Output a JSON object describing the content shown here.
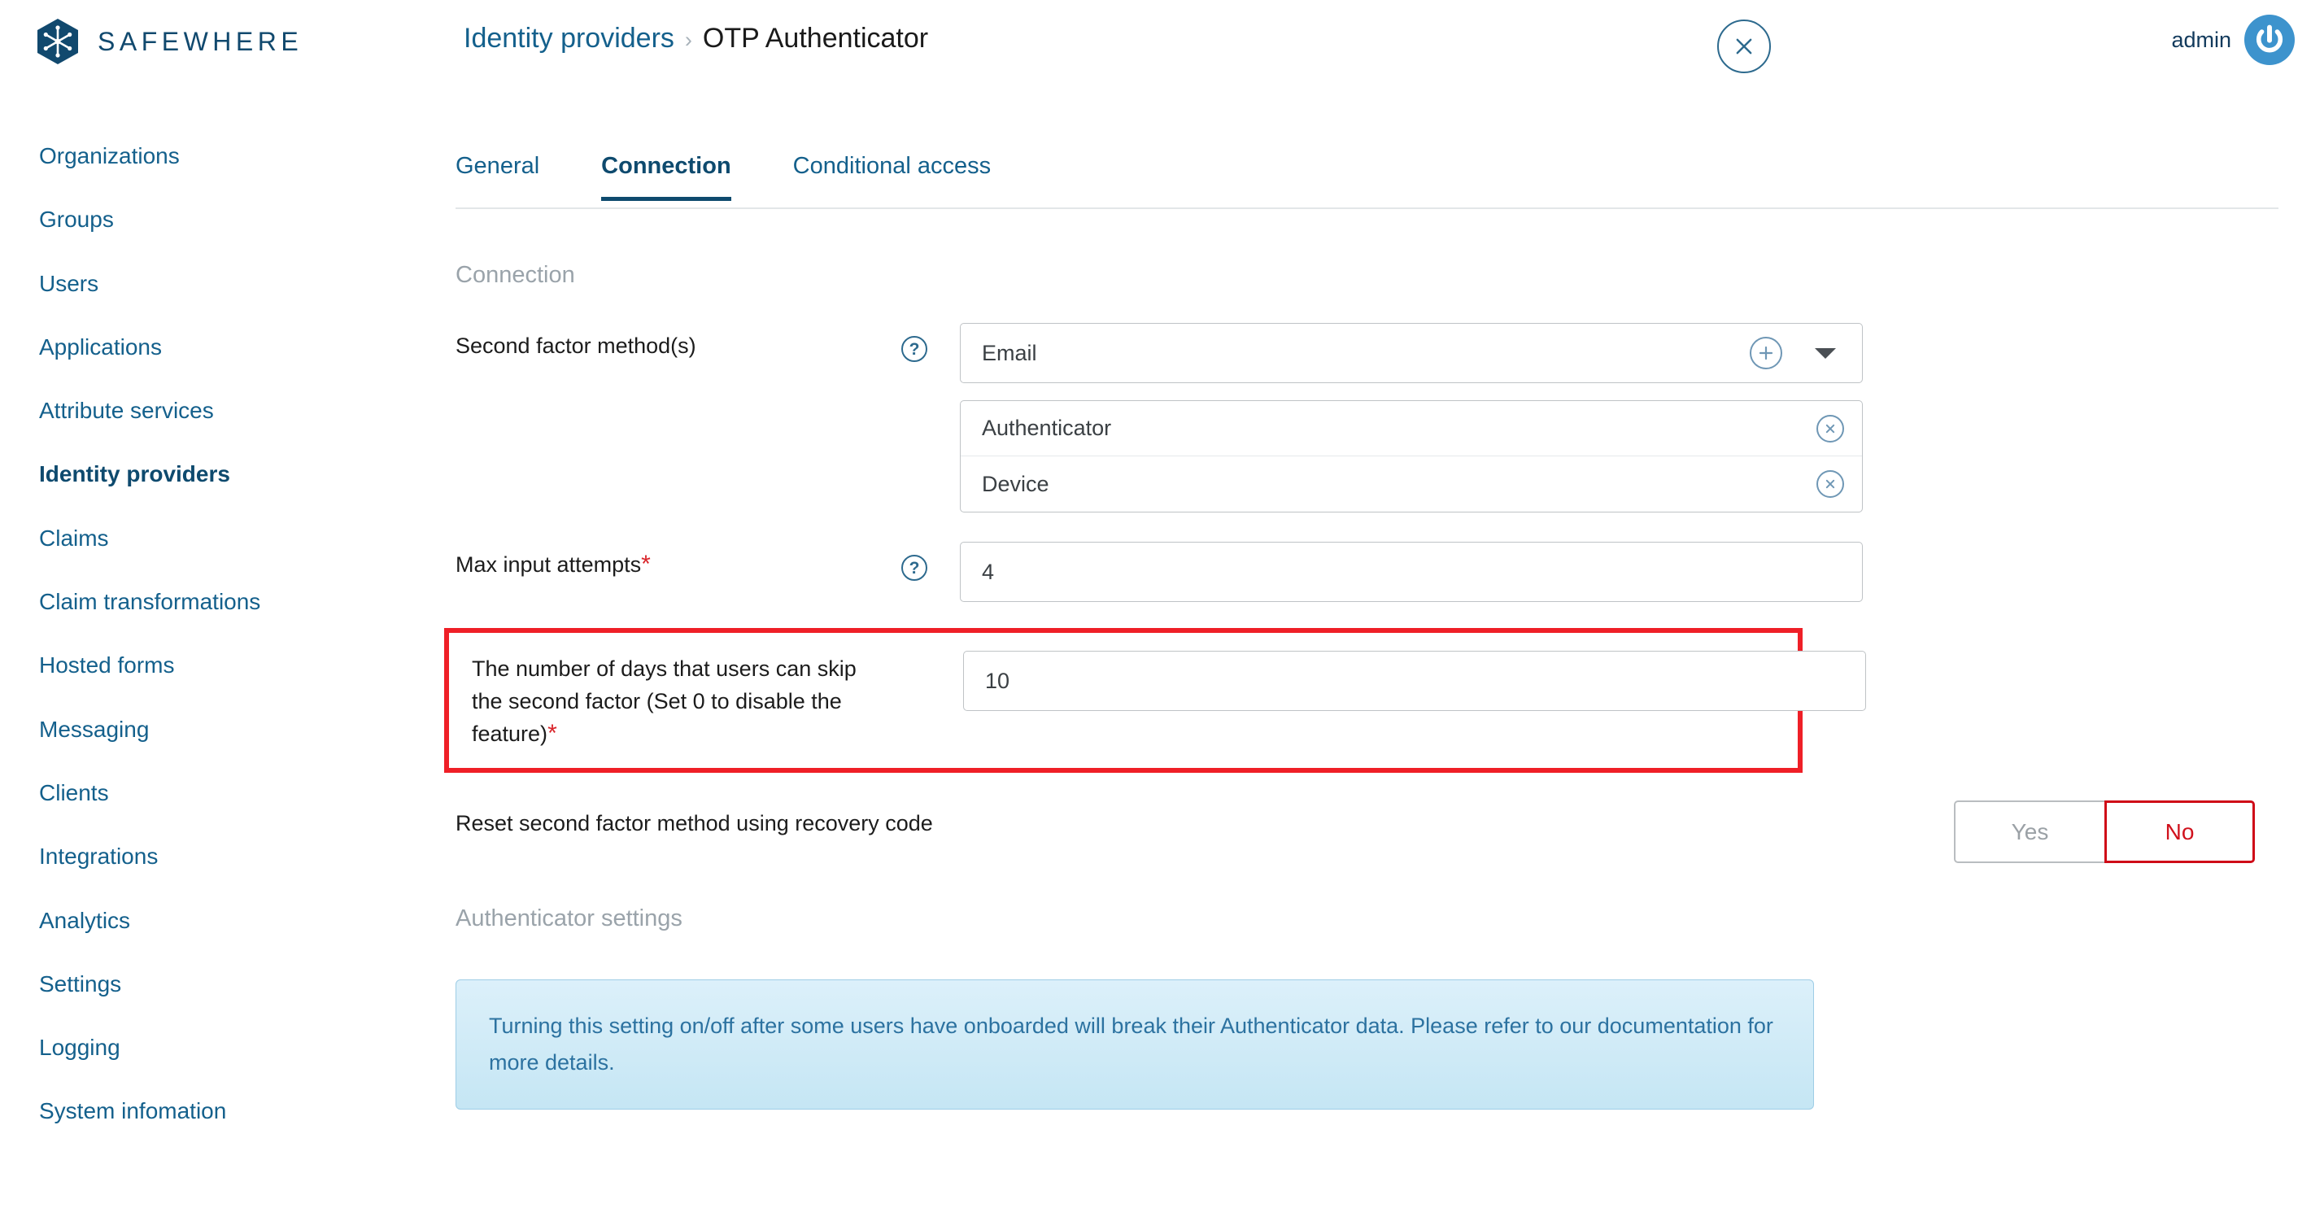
{
  "brand": {
    "name": "SAFEWHERE",
    "logo_icon": "snowflake-hexagon-icon"
  },
  "header": {
    "breadcrumb": {
      "parent": "Identity providers",
      "separator": "›",
      "current": "OTP Authenticator"
    },
    "close_icon": "close-icon",
    "user": {
      "name": "admin",
      "avatar_icon": "power-icon"
    }
  },
  "sidebar": {
    "items": [
      {
        "label": "Organizations",
        "active": false
      },
      {
        "label": "Groups",
        "active": false
      },
      {
        "label": "Users",
        "active": false
      },
      {
        "label": "Applications",
        "active": false
      },
      {
        "label": "Attribute services",
        "active": false
      },
      {
        "label": "Identity providers",
        "active": true
      },
      {
        "label": "Claims",
        "active": false
      },
      {
        "label": "Claim transformations",
        "active": false
      },
      {
        "label": "Hosted forms",
        "active": false
      },
      {
        "label": "Messaging",
        "active": false
      },
      {
        "label": "Clients",
        "active": false
      },
      {
        "label": "Integrations",
        "active": false
      },
      {
        "label": "Analytics",
        "active": false
      },
      {
        "label": "Settings",
        "active": false
      },
      {
        "label": "Logging",
        "active": false
      },
      {
        "label": "System infomation",
        "active": false
      }
    ]
  },
  "main": {
    "tabs": [
      {
        "label": "General",
        "active": false
      },
      {
        "label": "Connection",
        "active": true
      },
      {
        "label": "Conditional access",
        "active": false
      }
    ],
    "connection_section": {
      "title": "Connection",
      "second_factor": {
        "label": "Second factor method(s)",
        "help_icon": "question-mark-icon",
        "selected_value": "Email",
        "add_icon": "plus-circle-icon",
        "dropdown_icon": "chevron-down-icon",
        "chips": [
          {
            "label": "Authenticator",
            "remove_icon": "remove-circle-icon"
          },
          {
            "label": "Device",
            "remove_icon": "remove-circle-icon"
          }
        ]
      },
      "max_input_attempts": {
        "label": "Max input attempts",
        "required_marker": "*",
        "help_icon": "question-mark-icon",
        "value": "4"
      },
      "skip_days": {
        "label": "The number of days that users can skip the second factor (Set 0 to disable the feature)",
        "required_marker": "*",
        "value": "10",
        "highlighted": true,
        "highlight_color": "#ef1f27"
      },
      "reset_recovery": {
        "label": "Reset second factor method using recovery code",
        "yes_label": "Yes",
        "no_label": "No",
        "selected": "No"
      }
    },
    "authenticator_section": {
      "title": "Authenticator settings",
      "info_banner": "Turning this setting on/off after some users have onboarded will break their Authenticator data. Please refer to our documentation for more details."
    }
  },
  "colors": {
    "brand_blue": "#11496e",
    "link_blue": "#14608c",
    "accent_red": "#ef1f27",
    "banner_blue": "#2c72a0",
    "muted_gray": "#9aa3aa"
  }
}
